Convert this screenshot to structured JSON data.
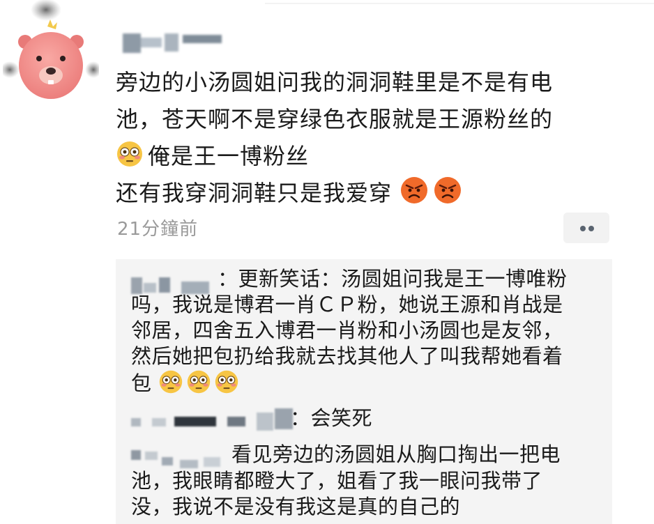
{
  "post": {
    "lines": [
      "旁边的小汤圆姐问我的洞洞鞋里是不是有电",
      "池，苍天啊不是穿绿色衣服就是王源粉丝的",
      "俺是王一博粉丝",
      "还有我穿洞洞鞋只是我爱穿"
    ],
    "timestamp": "21分鐘前"
  },
  "comments": {
    "c1": {
      "name_tail": "：",
      "line1": "更新笑话：汤圆姐问我是王一博唯粉",
      "line2": "吗，我说是博君一肖ＣＰ粉，她说王源和肖战是",
      "line3": "邻居，四舍五入博君一肖粉和小汤圆也是友邻，",
      "line4": "然后她把包扔给我就去找其他人了叫我帮她看着",
      "line5": "包"
    },
    "c2": {
      "text": "：会笑死"
    },
    "c3": {
      "line1": "看见旁边的汤圆姐从胸口掏出一把电",
      "line2": "池，我眼睛都瞪大了，姐看了我一眼问我带了",
      "line3": "没，我说不是没有我这是真的自己的"
    }
  },
  "icons": {
    "avatar": "pink-beaver-avatar",
    "flushed": "flushed-face-emoji",
    "angry": "angry-face-emoji",
    "more": "more-dots-icon"
  }
}
